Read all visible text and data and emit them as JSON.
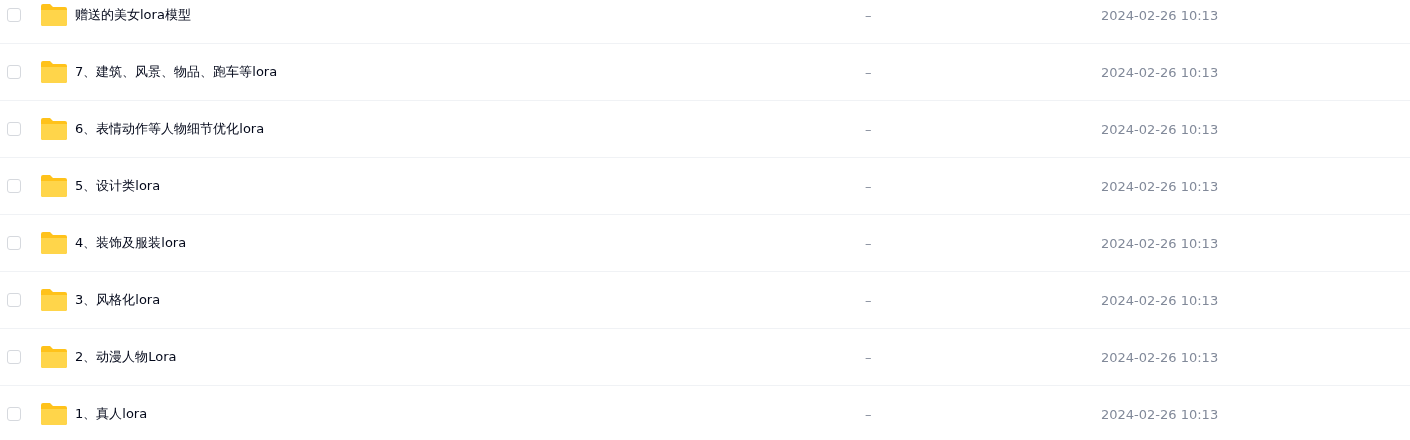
{
  "files": [
    {
      "name": "赠送的美女lora模型",
      "size": "–",
      "modified": "2024-02-26 10:13",
      "checked": false
    },
    {
      "name": "7、建筑、风景、物品、跑车等lora",
      "size": "–",
      "modified": "2024-02-26 10:13",
      "checked": false
    },
    {
      "name": "6、表情动作等人物细节优化lora",
      "size": "–",
      "modified": "2024-02-26 10:13",
      "checked": false
    },
    {
      "name": "5、设计类lora",
      "size": "–",
      "modified": "2024-02-26 10:13",
      "checked": false
    },
    {
      "name": "4、装饰及服装lora",
      "size": "–",
      "modified": "2024-02-26 10:13",
      "checked": false
    },
    {
      "name": "3、风格化lora",
      "size": "–",
      "modified": "2024-02-26 10:13",
      "checked": false
    },
    {
      "name": "2、动漫人物Lora",
      "size": "–",
      "modified": "2024-02-26 10:13",
      "checked": false
    },
    {
      "name": "1、真人lora",
      "size": "–",
      "modified": "2024-02-26 10:13",
      "checked": false
    }
  ]
}
